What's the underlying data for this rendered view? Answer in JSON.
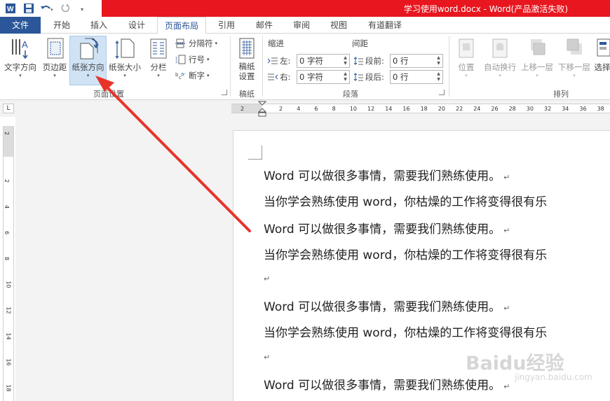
{
  "window": {
    "title": "学习使用word.docx -  Word(产品激活失败)"
  },
  "tabs": [
    {
      "label": "文件"
    },
    {
      "label": "开始"
    },
    {
      "label": "插入"
    },
    {
      "label": "设计"
    },
    {
      "label": "页面布局"
    },
    {
      "label": "引用"
    },
    {
      "label": "邮件"
    },
    {
      "label": "审阅"
    },
    {
      "label": "视图"
    },
    {
      "label": "有道翻译"
    }
  ],
  "ribbon": {
    "page_setup": {
      "text_direction": "文字方向",
      "margins": "页边距",
      "orientation": "纸张方向",
      "size": "纸张大小",
      "columns": "分栏",
      "breaks": "分隔符",
      "line_numbers": "行号",
      "hyphenation": "断字",
      "group_label": "页面设置"
    },
    "draft": {
      "button": "稿纸\n设置",
      "group_label": "稿纸"
    },
    "paragraph": {
      "indent_header": "缩进",
      "spacing_header": "间距",
      "left_label": "左:",
      "right_label": "右:",
      "before_label": "段前:",
      "after_label": "段后:",
      "left_value": "0 字符",
      "right_value": "0 字符",
      "before_value": "0 行",
      "after_value": "0 行",
      "group_label": "段落"
    },
    "arrange": {
      "position": "位置",
      "wrap": "自动换行",
      "bring_forward": "上移一层",
      "send_backward": "下移一层",
      "selection": "选择",
      "group_label": "排列"
    }
  },
  "ruler": {
    "corner": "L",
    "h_ticks": [
      "2",
      "2",
      "4",
      "6",
      "8",
      "10",
      "12",
      "14",
      "16",
      "18",
      "20",
      "22",
      "24",
      "26",
      "28",
      "30",
      "32",
      "34",
      "36",
      "38"
    ],
    "v_ticks": [
      "2",
      "2",
      "4",
      "6",
      "8",
      "10",
      "12",
      "14",
      "16",
      "18"
    ]
  },
  "document": {
    "lines": [
      "Word 可以做很多事情，需要我们熟练使用。",
      "当你学会熟练使用 word，你枯燥的工作将变得很有乐",
      "Word 可以做很多事情，需要我们熟练使用。",
      "当你学会熟练使用 word，你枯燥的工作将变得很有乐",
      "Word 可以做很多事情，需要我们熟练使用。",
      "当你学会熟练使用 word，你枯燥的工作将变得很有乐",
      "Word 可以做很多事情，需要我们熟练使用。"
    ],
    "para_mark": "↵"
  },
  "watermark": {
    "text": "Baidu经验",
    "sub": "jingyan.baidu.com"
  },
  "colors": {
    "title_red": "#e8171f",
    "word_blue": "#2b579a",
    "highlight": "#cfe3f5",
    "arrow": "#e8332a"
  }
}
